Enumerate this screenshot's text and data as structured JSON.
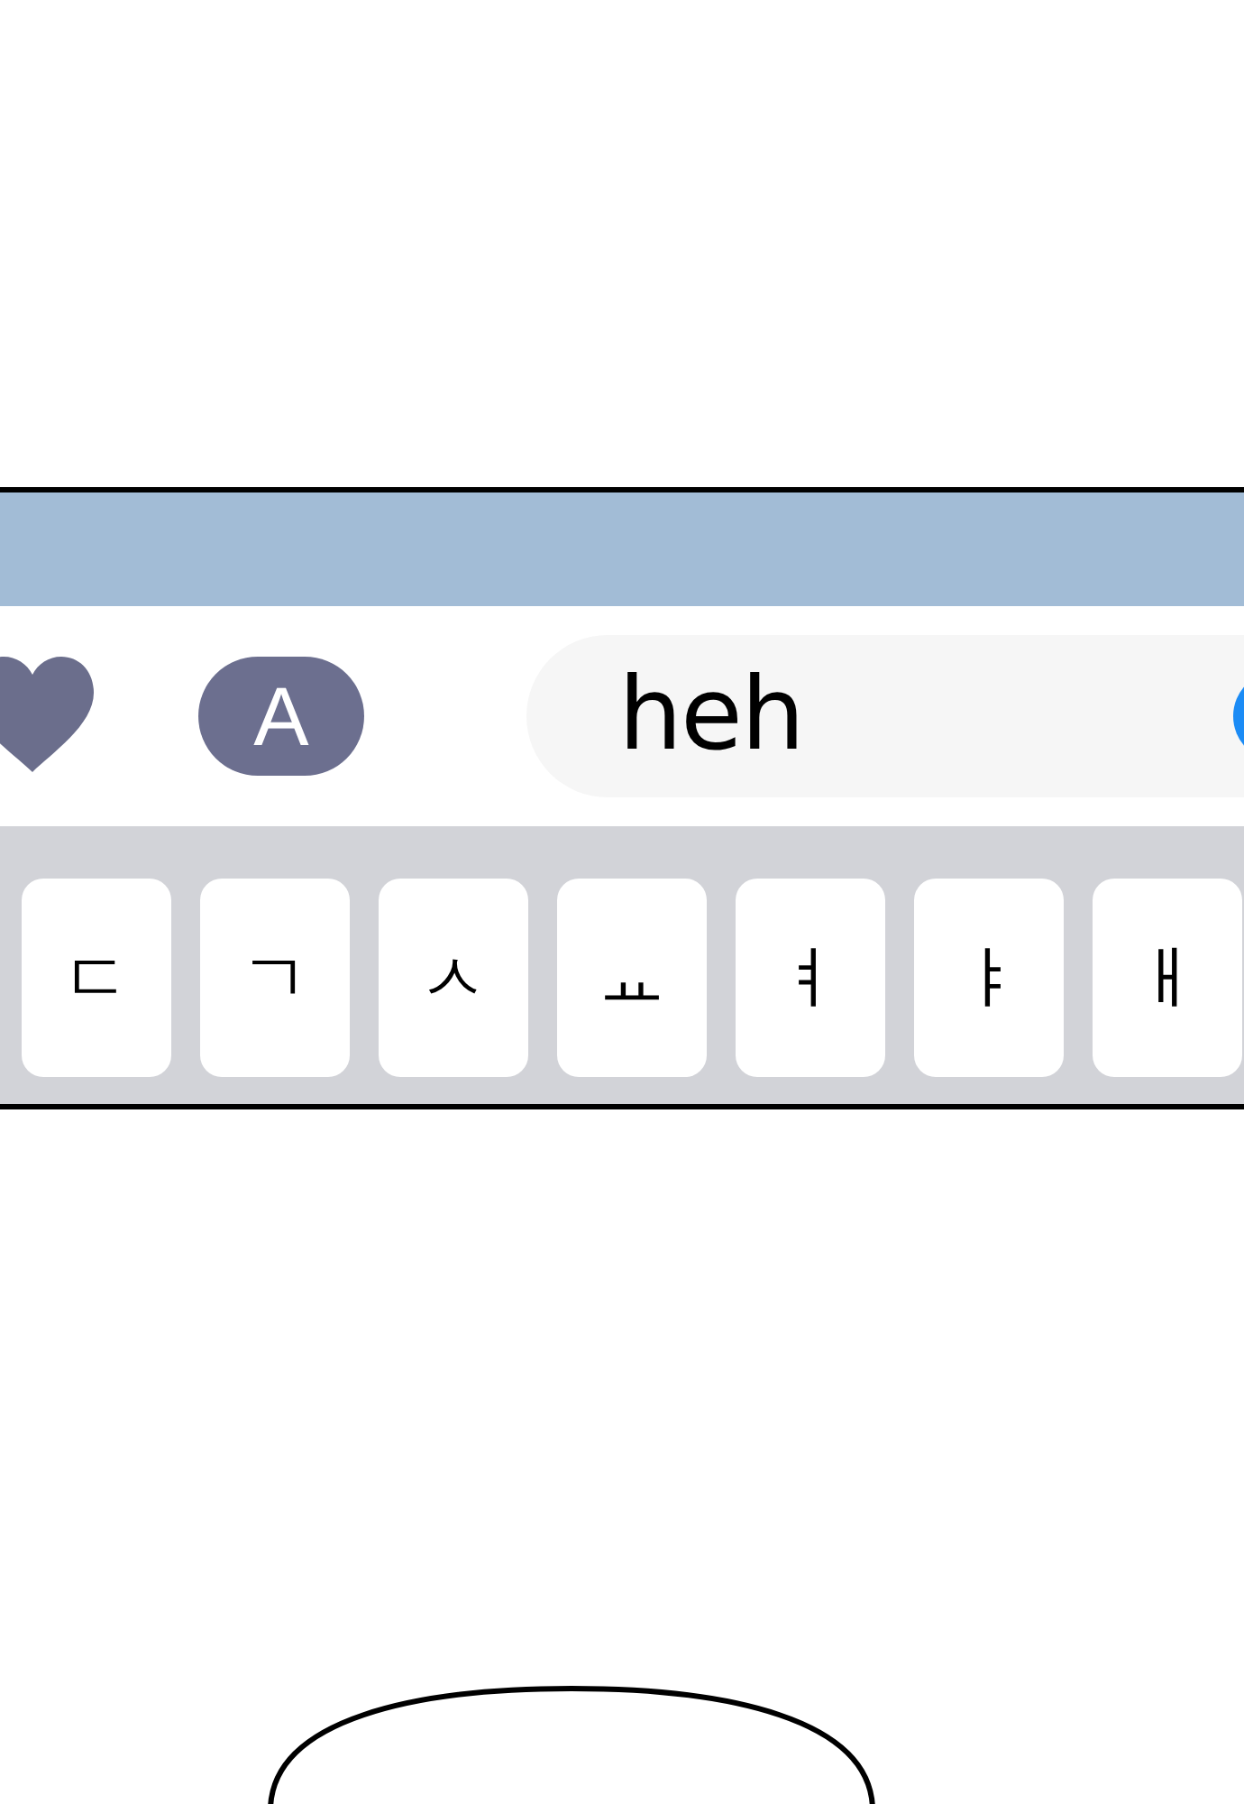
{
  "input_bar": {
    "apps_button": {
      "label": "A"
    },
    "message_field": {
      "value": "heh"
    }
  },
  "keyboard": {
    "keys": [
      {
        "label": "ㄷ"
      },
      {
        "label": "ㄱ"
      },
      {
        "label": "ㅅ"
      },
      {
        "label": "ㅛ"
      },
      {
        "label": "ㅕ"
      },
      {
        "label": "ㅑ"
      },
      {
        "label": "ㅐ"
      }
    ]
  }
}
